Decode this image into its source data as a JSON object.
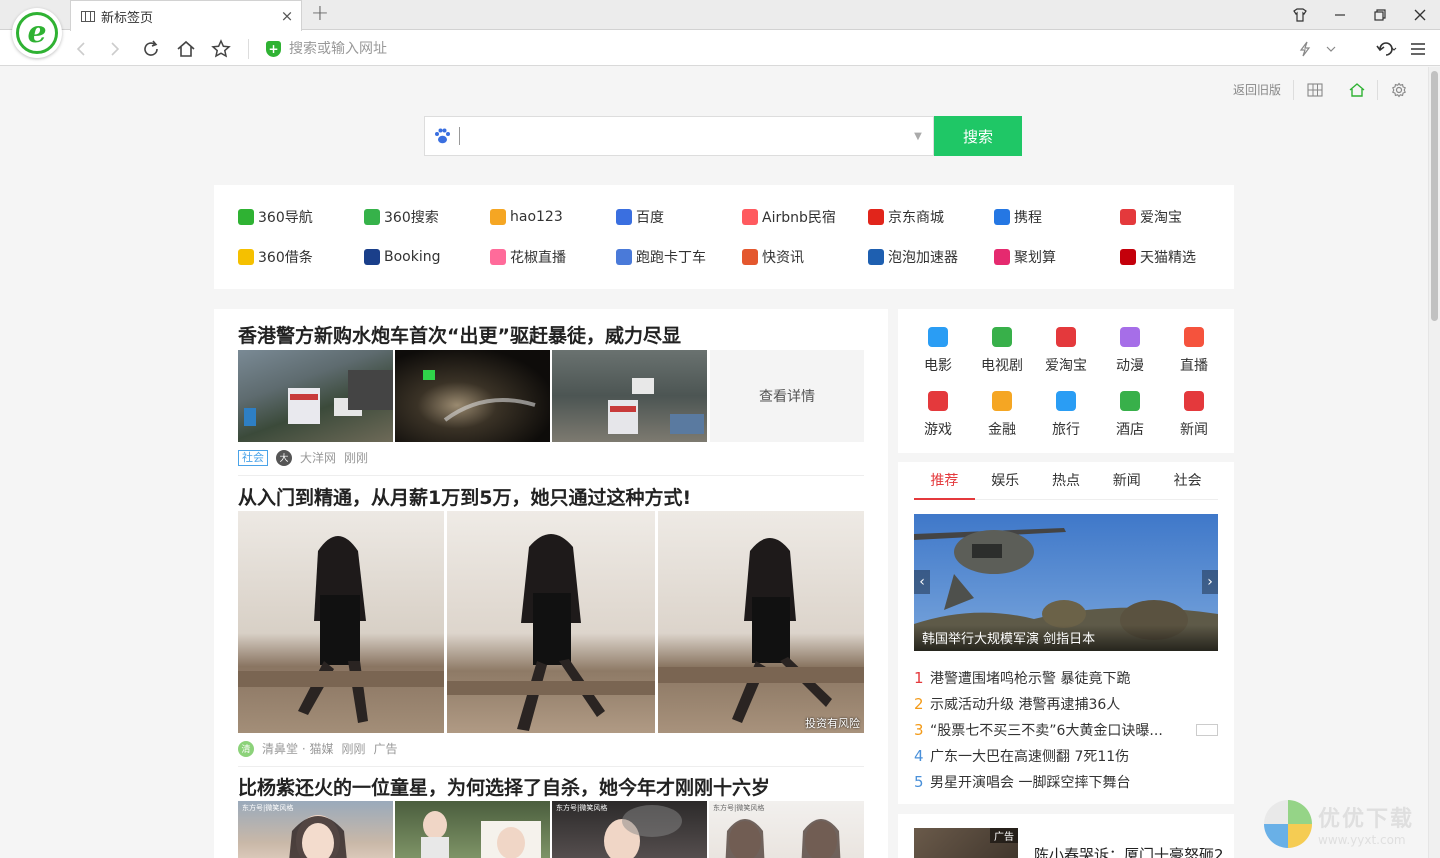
{
  "browser": {
    "tab_title": "新标签页",
    "tab_close": "×",
    "new_tab": "+",
    "address_placeholder": "搜索或输入网址"
  },
  "page_tools": {
    "back_old": "返回旧版"
  },
  "search": {
    "button_label": "搜索",
    "placeholder": ""
  },
  "sites": [
    {
      "label": "360导航",
      "icon": "nav-icon",
      "color": "#2fb233"
    },
    {
      "label": "360搜索",
      "icon": "search-360-icon",
      "color": "#36b24a"
    },
    {
      "label": "hao123",
      "icon": "hao123-icon",
      "color": "#f5a623"
    },
    {
      "label": "百度",
      "icon": "baidu-paw-icon",
      "color": "#3a6fe0"
    },
    {
      "label": "Airbnb民宿",
      "icon": "airbnb-icon",
      "color": "#ff5a5f"
    },
    {
      "label": "京东商城",
      "icon": "jd-icon",
      "color": "#e1251b"
    },
    {
      "label": "携程",
      "icon": "ctrip-icon",
      "color": "#2577e3"
    },
    {
      "label": "爱淘宝",
      "icon": "taobao-icon",
      "color": "#e4393c"
    },
    {
      "label": "360借条",
      "icon": "loan-icon",
      "color": "#f5c000"
    },
    {
      "label": "Booking",
      "icon": "booking-icon",
      "color": "#1a3f8a"
    },
    {
      "label": "花椒直播",
      "icon": "huajiao-icon",
      "color": "#ff6b9a"
    },
    {
      "label": "跑跑卡丁车",
      "icon": "kart-icon",
      "color": "#4a7ad9"
    },
    {
      "label": "快资讯",
      "icon": "kuai-icon",
      "color": "#e4572e"
    },
    {
      "label": "泡泡加速器",
      "icon": "bubble-icon",
      "color": "#1e5fb0"
    },
    {
      "label": "聚划算",
      "icon": "juhuasuan-icon",
      "color": "#e52a6f"
    },
    {
      "label": "天猫精选",
      "icon": "tmall-icon",
      "color": "#c4000b"
    }
  ],
  "feed": {
    "articles": [
      {
        "title": "香港警方新购水炮车首次“出更”驱赶暴徒，威力尽显",
        "more": "查看详情",
        "tag": "社会",
        "source": "大洋网",
        "time": "刚刚"
      },
      {
        "title": "从入门到精通，从月薪1万到5万，她只通过这种方式!",
        "source": "清鼻堂 · 猫媒",
        "time": "刚刚",
        "ad": "广告",
        "risk": "投资有风险"
      },
      {
        "title": "比杨紫还火的一位童星，为何选择了自杀，她今年才刚刚十六岁",
        "thumb_tag": "东方号|微笑风格"
      }
    ]
  },
  "categories": [
    {
      "label": "电影",
      "icon": "film-icon",
      "color": "#2a9df4"
    },
    {
      "label": "电视剧",
      "icon": "tv-icon",
      "color": "#38b04a"
    },
    {
      "label": "爱淘宝",
      "icon": "taobao-icon",
      "color": "#e4393c"
    },
    {
      "label": "动漫",
      "icon": "anime-icon",
      "color": "#a66ee8"
    },
    {
      "label": "直播",
      "icon": "live-icon",
      "color": "#f5533d"
    },
    {
      "label": "游戏",
      "icon": "game-icon",
      "color": "#e4393c"
    },
    {
      "label": "金融",
      "icon": "finance-icon",
      "color": "#f5a623"
    },
    {
      "label": "旅行",
      "icon": "plane-icon",
      "color": "#2a9df4"
    },
    {
      "label": "酒店",
      "icon": "hotel-icon",
      "color": "#38b04a"
    },
    {
      "label": "新闻",
      "icon": "news-icon",
      "color": "#e4393c"
    }
  ],
  "hot": {
    "tabs": [
      "推荐",
      "娱乐",
      "热点",
      "新闻",
      "社会"
    ],
    "active_tab": "推荐",
    "carousel_caption": "韩国举行大规模军演 剑指日本",
    "items": [
      {
        "num": "1",
        "text": "港警遭围堵鸣枪示警 暴徒竟下跪"
      },
      {
        "num": "2",
        "text": "示威活动升级 港警再逮捕36人"
      },
      {
        "num": "3",
        "text": "“股票七不买三不卖”6大黄金口诀曝..."
      },
      {
        "num": "4",
        "text": "广东一大巴在高速侧翻 7死11伤"
      },
      {
        "num": "5",
        "text": "男星开演唱会 一脚踩空摔下舞台"
      }
    ]
  },
  "bottom_card": {
    "ad": "广告",
    "title": "陈小春哭诉：厦门十豪怒砸2"
  },
  "watermark": {
    "main": "优优下载",
    "sub": "www.yyxt.com"
  }
}
